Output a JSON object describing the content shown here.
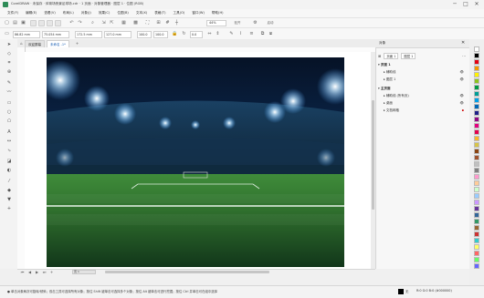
{
  "window": {
    "title": "CorelDRAW · 未保存 · 体育场夜景足球场.cdr · 1 页面 · 对象管理器 · 图层 1 · 位图 (RGB)",
    "min_label": "─",
    "max_label": "□",
    "close_label": "✕"
  },
  "menu": [
    "文件(F)",
    "编辑(E)",
    "查看(V)",
    "布局(L)",
    "对象(J)",
    "效果(C)",
    "位图(B)",
    "文本(X)",
    "表格(T)",
    "工具(O)",
    "窗口(W)",
    "帮助(H)"
  ],
  "toolbar": {
    "zoom_value": "44%",
    "snap_label": "贴齐",
    "launch_label": "启动"
  },
  "property_bar": {
    "x": "86.82 mm",
    "y": "75.054 mm",
    "w": "172.5 mm",
    "h": "127.0 mm",
    "sx": "100.0",
    "sy": "100.0",
    "angle": "0.0"
  },
  "tabs": {
    "welcome": "欢迎屏幕",
    "doc": "未命名 -1*"
  },
  "panel": {
    "title": "对象",
    "page_label": "页面 1",
    "layer_label": "图层 1",
    "layer_icon": "eye-icon",
    "rows": [
      "辅助线",
      "图层 1",
      "主页面",
      "辅助线 (所有页)",
      "桌面",
      "文档网格"
    ]
  },
  "page_nav": {
    "page_chip": "页 1"
  },
  "status": {
    "text": "● 单击对象两次可旋转/倾斜；双击工具可选择所有对象；按住 Shift 键单击可选择多个对象；按住 Alt 键单击可进行挖掘；按住 Ctrl 并单击可在组中选择",
    "fill_label": "无",
    "color_label": "R:0 G:0 B:0 (#000000)"
  },
  "palette": {
    "colors": [
      "#ffffff",
      "#000000",
      "#e60012",
      "#f39800",
      "#fff100",
      "#8fc31f",
      "#009944",
      "#009e96",
      "#00a0e9",
      "#0068b7",
      "#1d2088",
      "#920783",
      "#e4007f",
      "#e5004f",
      "#f8b62d",
      "#d7c447",
      "#8b4513",
      "#a0522d",
      "#c0c0c0",
      "#808080",
      "#ff99cc",
      "#ffcc99",
      "#ccffcc",
      "#99ccff",
      "#cc99ff",
      "#663399",
      "#336699",
      "#339966",
      "#996633",
      "#cc3333",
      "#33cccc",
      "#ffff66",
      "#ff6666",
      "#66ff66",
      "#6666ff"
    ]
  },
  "canvas": {
    "subject": "night football stadium with floodlights and green pitch"
  }
}
